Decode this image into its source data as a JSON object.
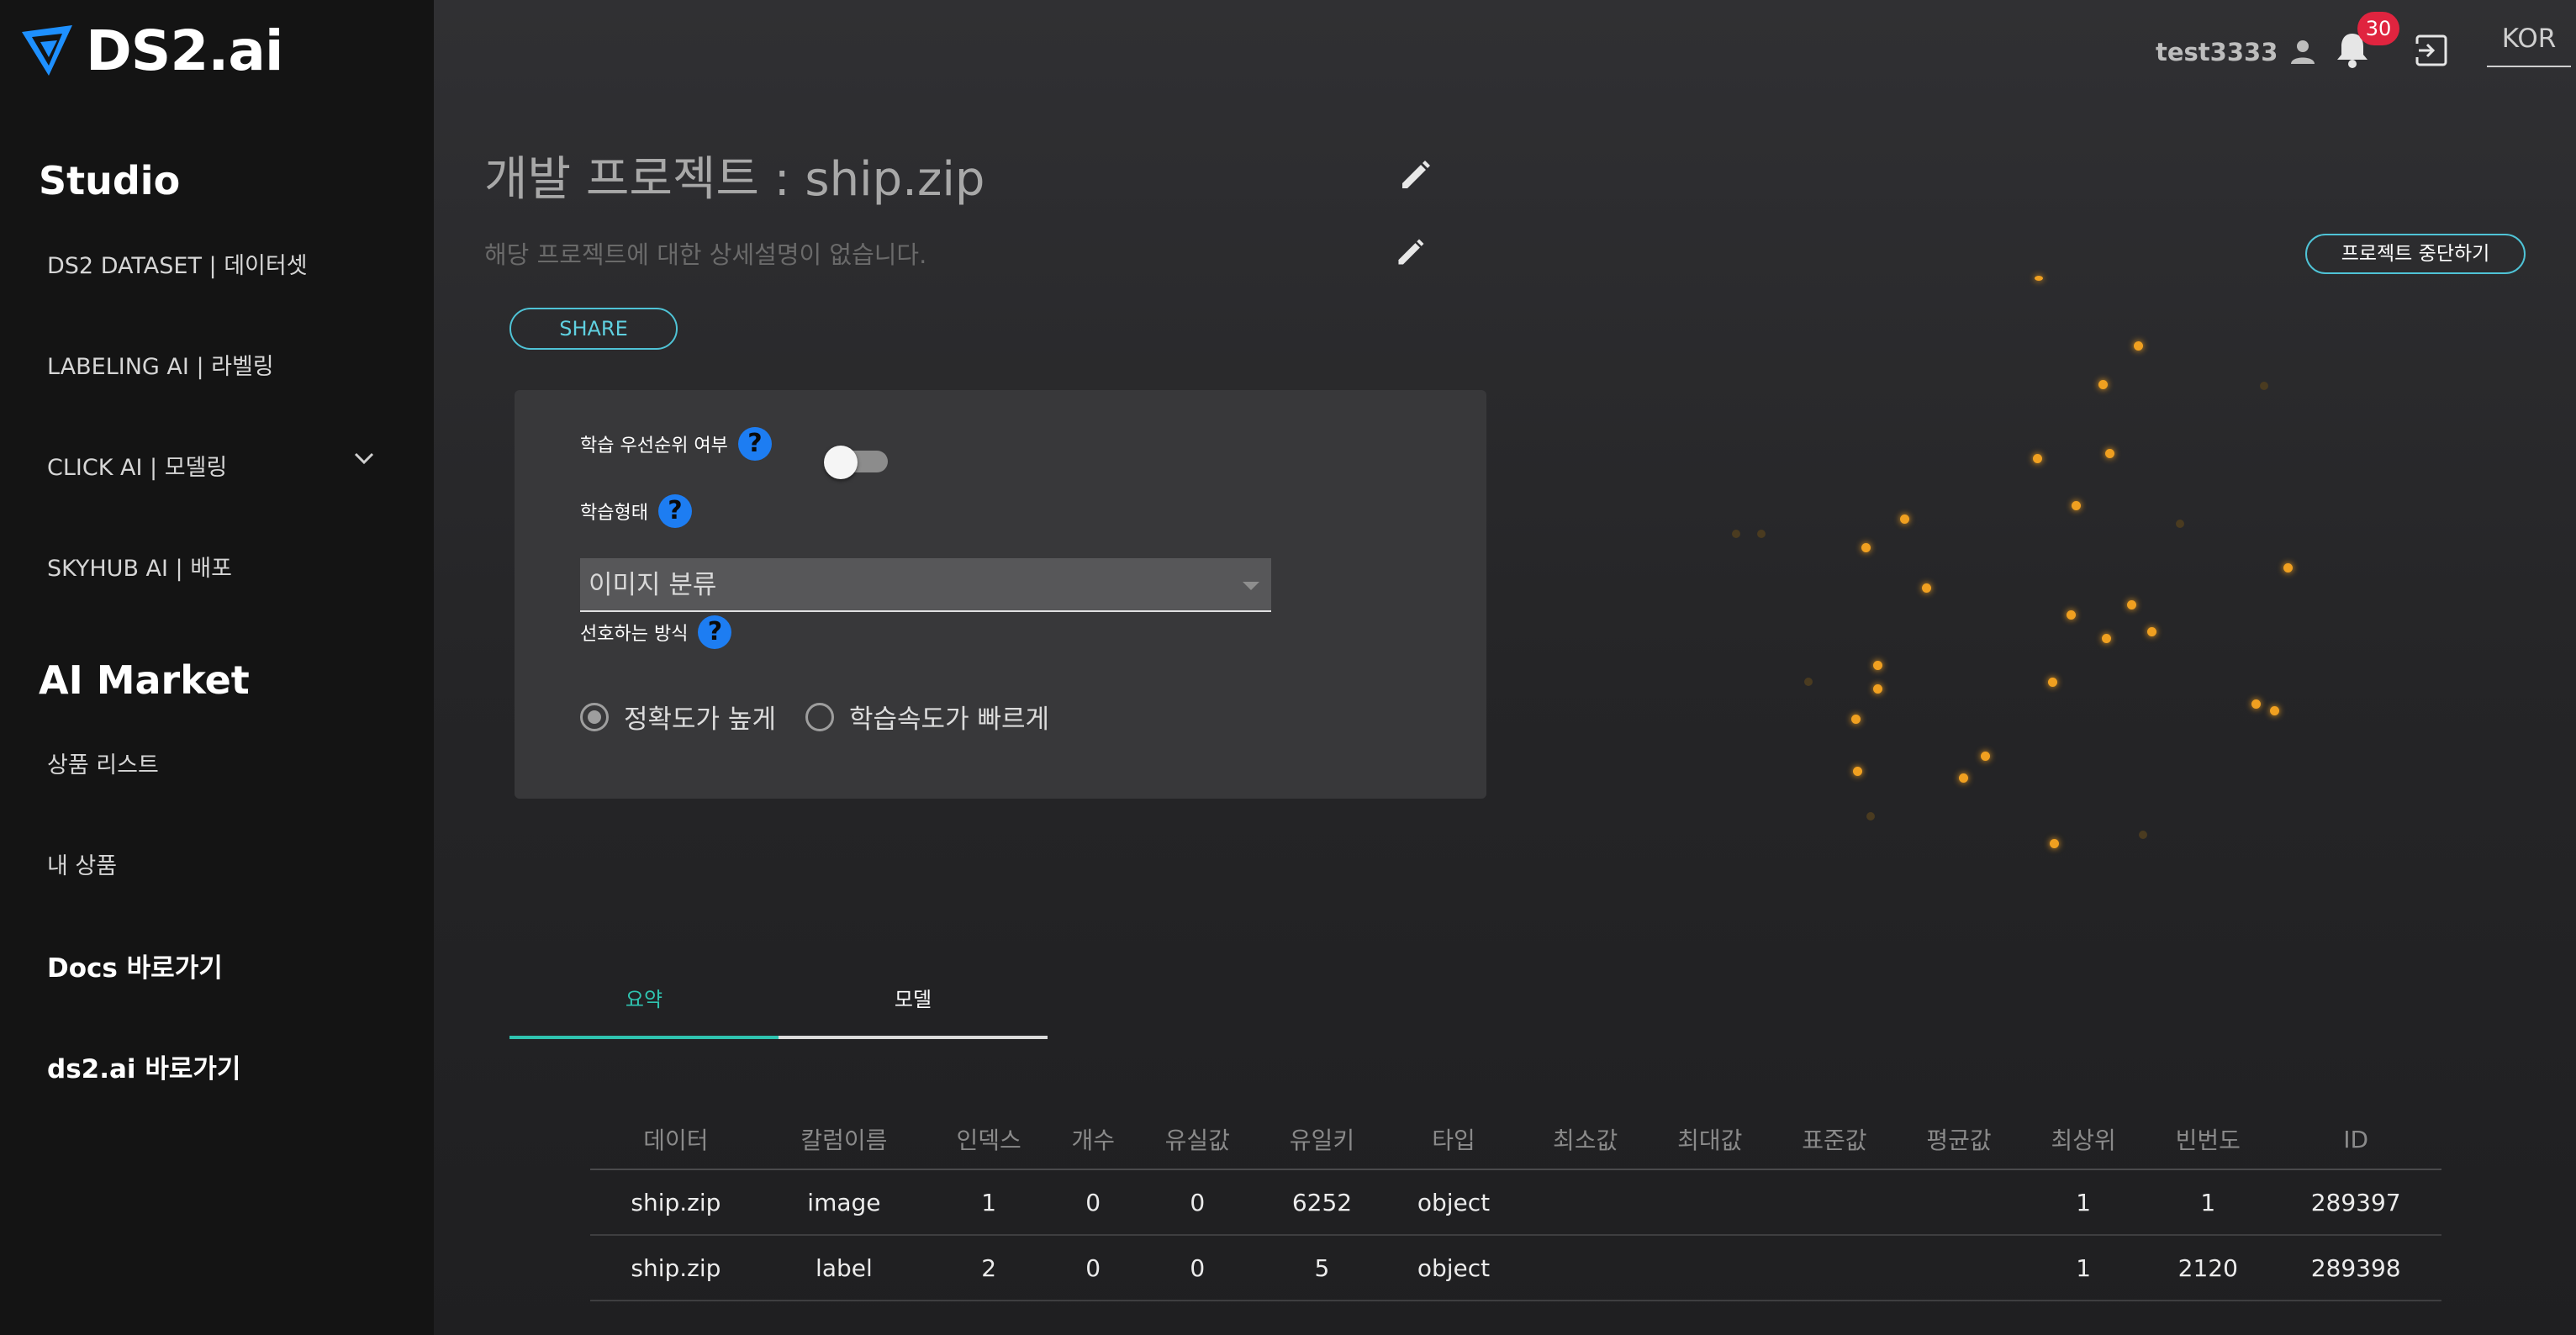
{
  "brand": {
    "name": "DS2.ai"
  },
  "sidebar": {
    "studio_title": "Studio",
    "studio_items": [
      {
        "label": "DS2 DATASET | 데이터셋"
      },
      {
        "label": "LABELING AI | 라벨링"
      },
      {
        "label": "CLICK AI | 모델링"
      },
      {
        "label": "SKYHUB AI | 배포"
      }
    ],
    "market_title": "AI Market",
    "market_items": [
      {
        "label": "상품 리스트"
      },
      {
        "label": "내 상품"
      }
    ],
    "links": [
      {
        "label": "Docs 바로가기"
      },
      {
        "label": "ds2.ai 바로가기"
      }
    ]
  },
  "topbar": {
    "username": "test3333",
    "notification_count": "30",
    "language": "KOR"
  },
  "project": {
    "title": "개발 프로젝트 : ship.zip",
    "description": "해당 프로젝트에 대한 상세설명이 없습니다.",
    "share_label": "SHARE",
    "stop_label": "프로젝트 중단하기"
  },
  "settings": {
    "priority_label": "학습 우선순위 여부",
    "priority_enabled": false,
    "training_type_label": "학습형태",
    "training_type_value": "이미지 분류",
    "preference_label": "선호하는 방식",
    "options": [
      {
        "label": "정확도가 높게",
        "selected": true
      },
      {
        "label": "학습속도가 빠르게",
        "selected": false
      }
    ]
  },
  "tabs": [
    {
      "label": "요약",
      "active": true
    },
    {
      "label": "모델",
      "active": false
    }
  ],
  "table": {
    "headers": [
      "데이터",
      "칼럼이름",
      "인덱스",
      "개수",
      "유실값",
      "유일키",
      "타입",
      "최소값",
      "최대값",
      "표준값",
      "평균값",
      "최상위",
      "빈번도",
      "ID"
    ],
    "rows": [
      [
        "ship.zip",
        "image",
        "1",
        "0",
        "0",
        "6252",
        "object",
        "",
        "",
        "",
        "",
        "1",
        "1",
        "289397"
      ],
      [
        "ship.zip",
        "label",
        "2",
        "0",
        "0",
        "5",
        "object",
        "",
        "",
        "",
        "",
        "1",
        "2120",
        "289398"
      ]
    ]
  },
  "colors": {
    "accent_teal": "#2fc4b0",
    "accent_cyan": "#4fc3d6",
    "help_blue": "#1d7df2",
    "badge_red": "#e0243f",
    "particle_orange": "#f0a020"
  }
}
